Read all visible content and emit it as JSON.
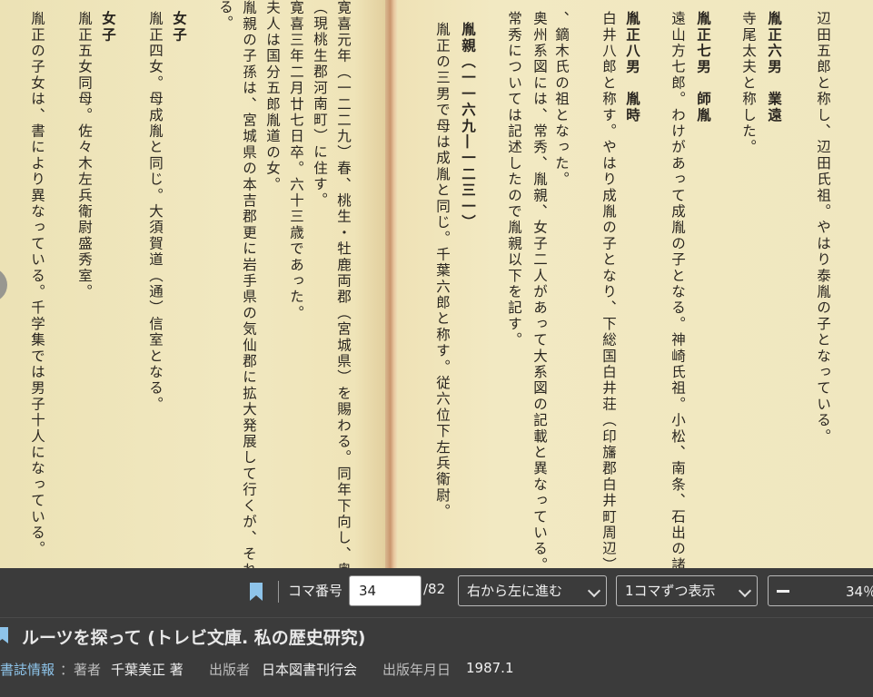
{
  "book": {
    "right_columns": [
      {
        "text": "辺田五郎と称し、辺田氏祖。やはり泰胤の子となっている。",
        "bold": false
      },
      {
        "text": "寺尾太夫と称した。",
        "bold": false
      },
      {
        "text": "胤正六男　業遠",
        "bold": true
      },
      {
        "text": "遠山方七郎。わけがあって成胤の子となる。神崎氏祖。小松、南条、石出の諸氏分出。",
        "bold": false
      },
      {
        "text": "胤正七男　師胤",
        "bold": true
      },
      {
        "text": "白井八郎と称す。やはり成胤の子となり、下総国白井荘（印旛郡白井町周辺）を分与され",
        "bold": false
      },
      {
        "text": "胤正八男　胤時",
        "bold": true
      },
      {
        "text": "、鏑木氏の祖となった。",
        "bold": false
      },
      {
        "text": "奥州系図には、常秀、胤親、女子二人があって大系図の記載と異なっている。",
        "bold": false
      },
      {
        "text": "常秀については記述したので胤親以下を記す。",
        "bold": false
      },
      {
        "text": "胤親（一一六九―一二三一）",
        "bold": true
      },
      {
        "text": "胤正の三男で母は成胤と同じ。千葉六郎と称す。従六位下左兵衛尉。",
        "bold": false
      }
    ],
    "left_columns": [
      {
        "text": "寛喜元年（一二二九）春、桃生・牡鹿両郡（宮城県）を賜わる。同年下向し、奥州桃生郡",
        "bold": false
      },
      {
        "text": "庄（現桃生郡河南町）に住す。",
        "bold": false
      },
      {
        "text": "寛喜三年二月廿七日卒。六十三歳であった。",
        "bold": false
      },
      {
        "text": "夫人は国分五郎胤道の女。",
        "bold": false
      },
      {
        "text": "胤親の子孫は、宮城県の本吉郡更に岩手県の気仙郡に拡大発展して行くが、それについて",
        "bold": false
      },
      {
        "text": "述する。",
        "bold": false
      },
      {
        "text": "女子",
        "bold": true
      },
      {
        "text": "胤正四女。母成胤と同じ。大須賀道（通）信室となる。",
        "bold": false
      },
      {
        "text": "女子",
        "bold": true
      },
      {
        "text": "胤正五女同母。佐々木左兵衛尉盛秀室。",
        "bold": false
      },
      {
        "text": "胤正の子女は、書により異なっている。千学集では男子十人になっている。",
        "bold": false
      }
    ]
  },
  "toolbar": {
    "frame_label": "コマ番号",
    "frame_value": "34",
    "frame_total": "/82",
    "direction": "右から左に進む",
    "display_mode": "1コマずつ表示",
    "zoom": "34％"
  },
  "info": {
    "title": "ルーツを探って (トレビ文庫. 私の歴史研究)",
    "biblio_link": "書誌情報",
    "author_key": "：著者",
    "author": "千葉美正 著",
    "publisher_key": "出版者",
    "publisher": "日本図書刊行会",
    "date_key": "出版年月日",
    "date": "1987.1"
  },
  "colors": {
    "accent_link": "#8ec4ea",
    "bookmark": "#8ec4ea",
    "paper": "#efe6bd"
  }
}
